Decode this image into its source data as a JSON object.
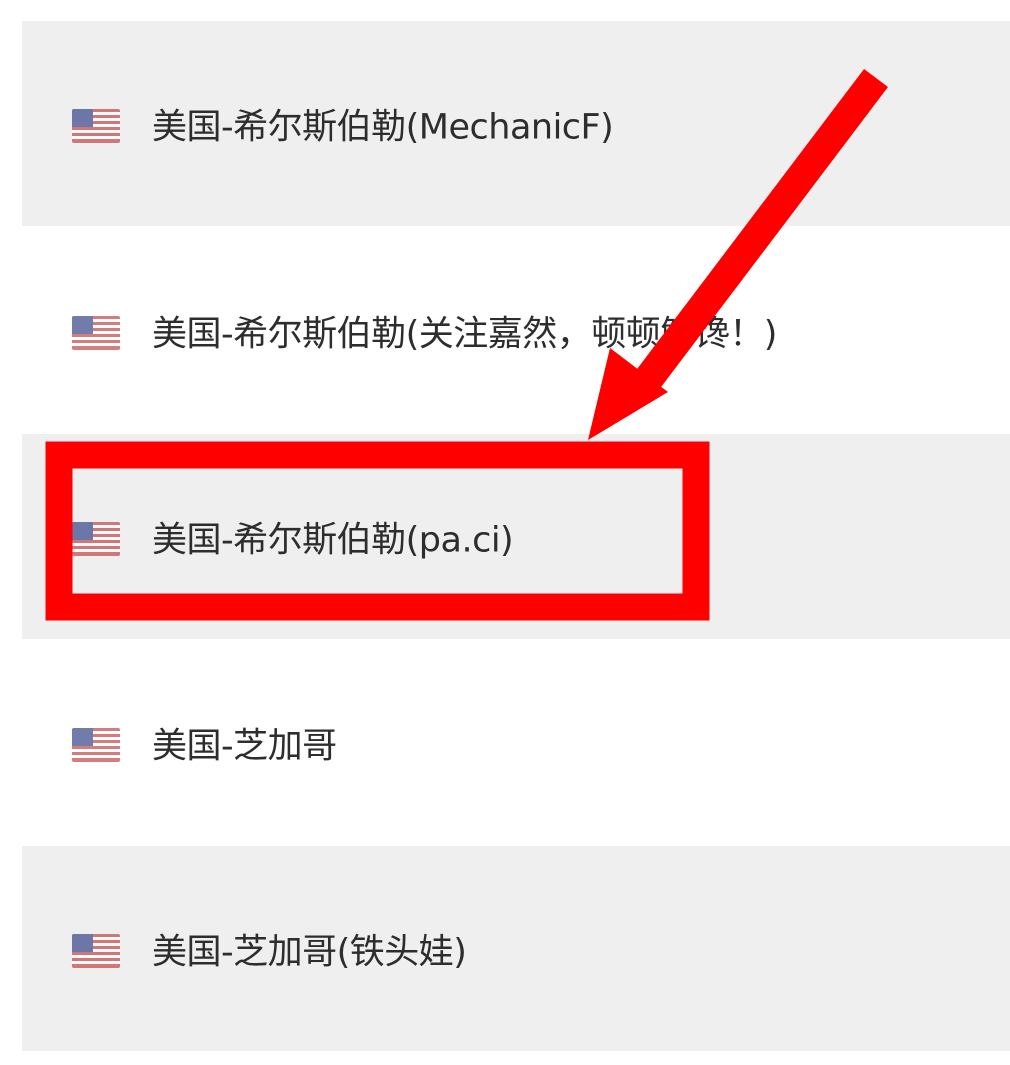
{
  "server_list": {
    "items": [
      {
        "label": "美国-希尔斯伯勒(MechanicF)",
        "flag_icon": "us-flag-icon"
      },
      {
        "label": "美国-希尔斯伯勒(关注嘉然，顿顿解馋！)",
        "flag_icon": "us-flag-icon"
      },
      {
        "label": "美国-希尔斯伯勒(pa.ci)",
        "flag_icon": "us-flag-icon"
      },
      {
        "label": "美国-芝加哥",
        "flag_icon": "us-flag-icon"
      },
      {
        "label": "美国-芝加哥(铁头娃)",
        "flag_icon": "us-flag-icon"
      }
    ]
  },
  "annotation": {
    "color": "#ff0000",
    "highlighted_item": "美国-希尔斯伯勒(pa.ci)"
  },
  "colors": {
    "row_shaded": "#efefef",
    "row_plain": "#ffffff",
    "text": "#2d2d2d"
  }
}
